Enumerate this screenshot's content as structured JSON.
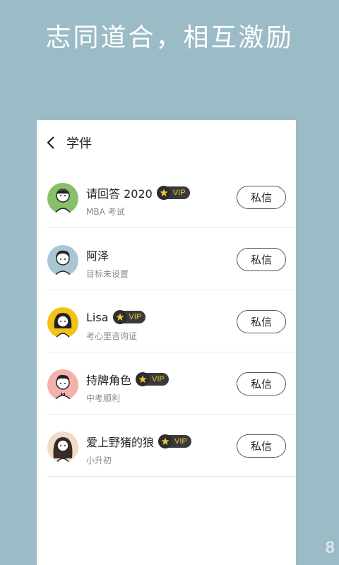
{
  "promo": {
    "title": "志同道合，相互激励"
  },
  "header": {
    "title": "学伴"
  },
  "users": [
    {
      "name": "请回答 2020",
      "vip": true,
      "subtitle": "MBA 考试",
      "button": "私信",
      "avatar_bg": "#88c06a"
    },
    {
      "name": "阿泽",
      "vip": false,
      "subtitle": "目标未设置",
      "button": "私信",
      "avatar_bg": "#a9c6d3"
    },
    {
      "name": "Lisa",
      "vip": true,
      "subtitle": "考心里咨询证",
      "button": "私信",
      "avatar_bg": "#f2c21a"
    },
    {
      "name": "持牌角色",
      "vip": true,
      "subtitle": "中考顺利",
      "button": "私信",
      "avatar_bg": "#f4b0ab"
    },
    {
      "name": "爱上野猪的狼",
      "vip": true,
      "subtitle": "小升初",
      "button": "私信",
      "avatar_bg": "#efdcc8"
    }
  ],
  "vip_label": "VIP",
  "watermark": "8",
  "colors": {
    "background": "#9bbbc6",
    "vip_text": "#f2c23a"
  }
}
